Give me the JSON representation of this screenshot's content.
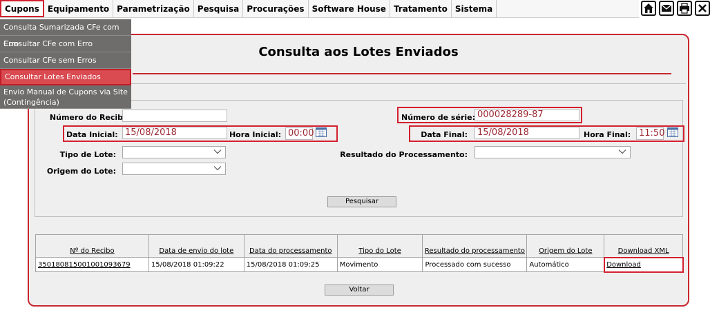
{
  "menu": {
    "items": [
      "Cupons",
      "Equipamento",
      "Parametrização",
      "Pesquisa",
      "Procurações",
      "Software House",
      "Tratamento",
      "Sistema"
    ]
  },
  "toolbar": {
    "icons": [
      "home-icon",
      "mail-icon",
      "print-icon",
      "close-icon"
    ]
  },
  "dropdown": {
    "items": [
      "Consulta Sumarizada CFe com Erro",
      "Consultar CFe com Erro",
      "Consultar CFe sem Erros",
      "Consultar Lotes Enviados",
      "Envio Manual de Cupons via Site",
      "(Contingência)"
    ],
    "selected": "Consultar Lotes Enviados"
  },
  "page": {
    "title": "Consulta aos Lotes Enviados"
  },
  "form": {
    "numero_recibo": {
      "label": "Número do Recibo:",
      "value": ""
    },
    "numero_serie": {
      "label": "Número de série:",
      "value": "000028289-87"
    },
    "data_inicial": {
      "label": "Data Inicial:",
      "value": "15/08/2018"
    },
    "hora_inicial": {
      "label": "Hora Inicial:",
      "value": "00:00"
    },
    "data_final": {
      "label": "Data Final:",
      "value": "15/08/2018"
    },
    "hora_final": {
      "label": "Hora Final:",
      "value": "11:50"
    },
    "tipo_lote": {
      "label": "Tipo de Lote:",
      "value": ""
    },
    "resultado": {
      "label": "Resultado do Processamento:",
      "value": ""
    },
    "origem_lote": {
      "label": "Origem do Lote:",
      "value": ""
    },
    "pesquisar_label": "Pesquisar"
  },
  "table": {
    "headers": [
      "Nº do Recibo",
      "Data de envio do lote",
      "Data do processamento",
      "Tipo do Lote",
      "Resultado do processamento",
      "Origem do Lote",
      "Download XML"
    ],
    "rows": [
      {
        "recibo": "350180815001001093679",
        "data_envio": "15/08/2018 01:09:22",
        "data_processamento": "15/08/2018 01:09:25",
        "tipo": "Movimento",
        "resultado": "Processado com sucesso",
        "origem": "Automático",
        "download": "Download"
      }
    ]
  },
  "voltar_label": "Voltar",
  "colors": {
    "accent": "#c8262f",
    "menu_bg": "#6e6d6c",
    "selected_bg": "#d94a51"
  }
}
